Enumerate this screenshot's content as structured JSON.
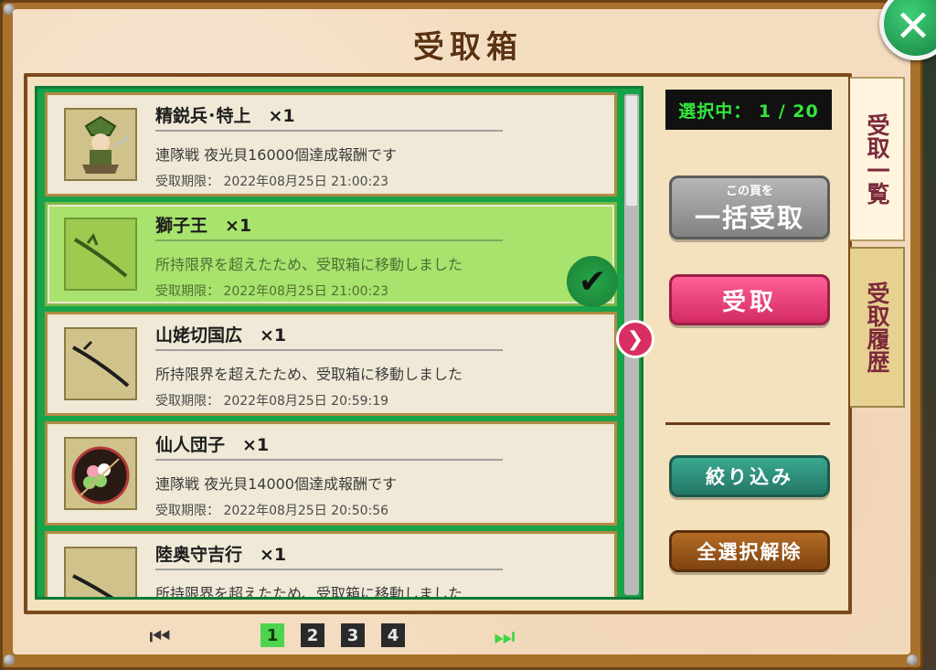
{
  "title": "受取箱",
  "close_icon": "close-icon",
  "counter_text": "選択中： 1 / 20",
  "bulk_button": {
    "small": "この頁を",
    "big": "一括受取"
  },
  "receive_button": "受取",
  "filter_button": "絞り込み",
  "deselect_button": "全選択解除",
  "tabs": {
    "list": "受取一覧",
    "history": "受取履歴"
  },
  "items": [
    {
      "name": "精鋭兵･特上　×1",
      "desc": "連隊戦 夜光貝16000個達成報酬です",
      "date": "受取期限：  2022年08月25日 21:00:23",
      "icon": "soldier-icon",
      "selected": false
    },
    {
      "name": "獅子王　×1",
      "desc": "所持限界を超えたため、受取箱に移動しました",
      "date": "受取期限：  2022年08月25日 21:00:23",
      "icon": "sword-icon",
      "selected": true
    },
    {
      "name": "山姥切国広　×1",
      "desc": "所持限界を超えたため、受取箱に移動しました",
      "date": "受取期限：  2022年08月25日 20:59:19",
      "icon": "sword-icon",
      "selected": false
    },
    {
      "name": "仙人団子　×1",
      "desc": "連隊戦 夜光貝14000個達成報酬です",
      "date": "受取期限：  2022年08月25日 20:50:56",
      "icon": "dango-icon",
      "selected": false
    },
    {
      "name": "陸奥守吉行　×1",
      "desc": "所持限界を超えたため、受取箱に移動しました",
      "date": "",
      "icon": "sword-icon",
      "selected": false
    }
  ],
  "pagination": {
    "pages": [
      "1",
      "2",
      "3",
      "4"
    ],
    "active": "1"
  },
  "colors": {
    "list_green": "#17a34a",
    "selected_item": "#a8e36d",
    "receive_pink": "#d42a62",
    "counter_green": "#34e63c"
  }
}
